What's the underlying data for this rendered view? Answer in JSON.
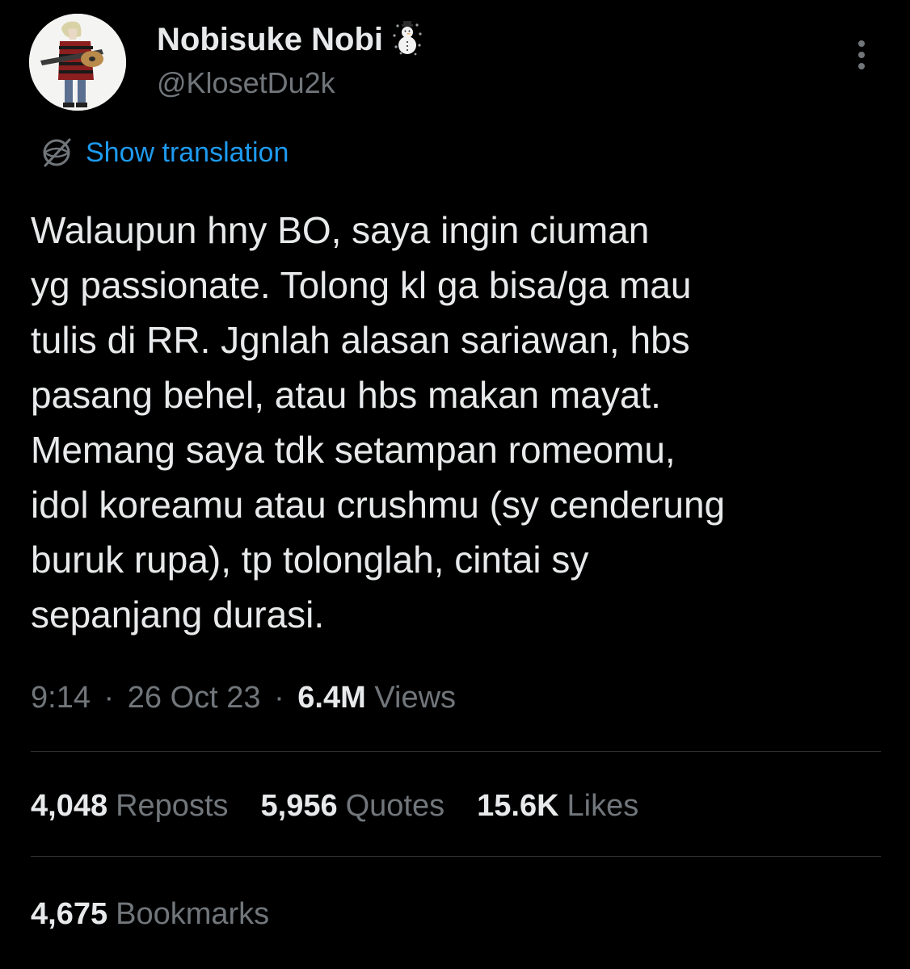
{
  "author": {
    "display_name": "Nobisuke Nobi",
    "badge_icon": "snowman-icon",
    "handle": "@KlosetDu2k",
    "avatar_icon": "person-with-guitar-avatar"
  },
  "translate": {
    "icon": "globe-icon",
    "label": "Show translation",
    "color": "#1d9bf0"
  },
  "tweet": {
    "lines": [
      "Walaupun hny BO, saya ingin ciuman",
      "yg passionate. Tolong kl ga bisa/ga mau",
      "tulis di RR. Jgnlah alasan sariawan, hbs",
      "pasang behel, atau hbs makan mayat.",
      "Memang saya tdk setampan romeomu,",
      "idol koreamu atau crushmu (sy cenderung",
      "buruk rupa), tp tolonglah, cintai sy",
      "sepanjang durasi."
    ]
  },
  "meta": {
    "time": "9:14",
    "separator": "·",
    "date": "26 Oct 23",
    "views_count": "6.4M",
    "views_label": "Views"
  },
  "stats": [
    {
      "count": "4,048",
      "label": "Reposts"
    },
    {
      "count": "5,956",
      "label": "Quotes"
    },
    {
      "count": "15.6K",
      "label": "Likes"
    }
  ],
  "bookmarks": {
    "count": "4,675",
    "label": "Bookmarks"
  },
  "colors": {
    "background": "#000000",
    "primary_text": "#e7e9ea",
    "secondary_text": "#71767b",
    "divider": "#2f3336",
    "accent": "#1d9bf0"
  }
}
